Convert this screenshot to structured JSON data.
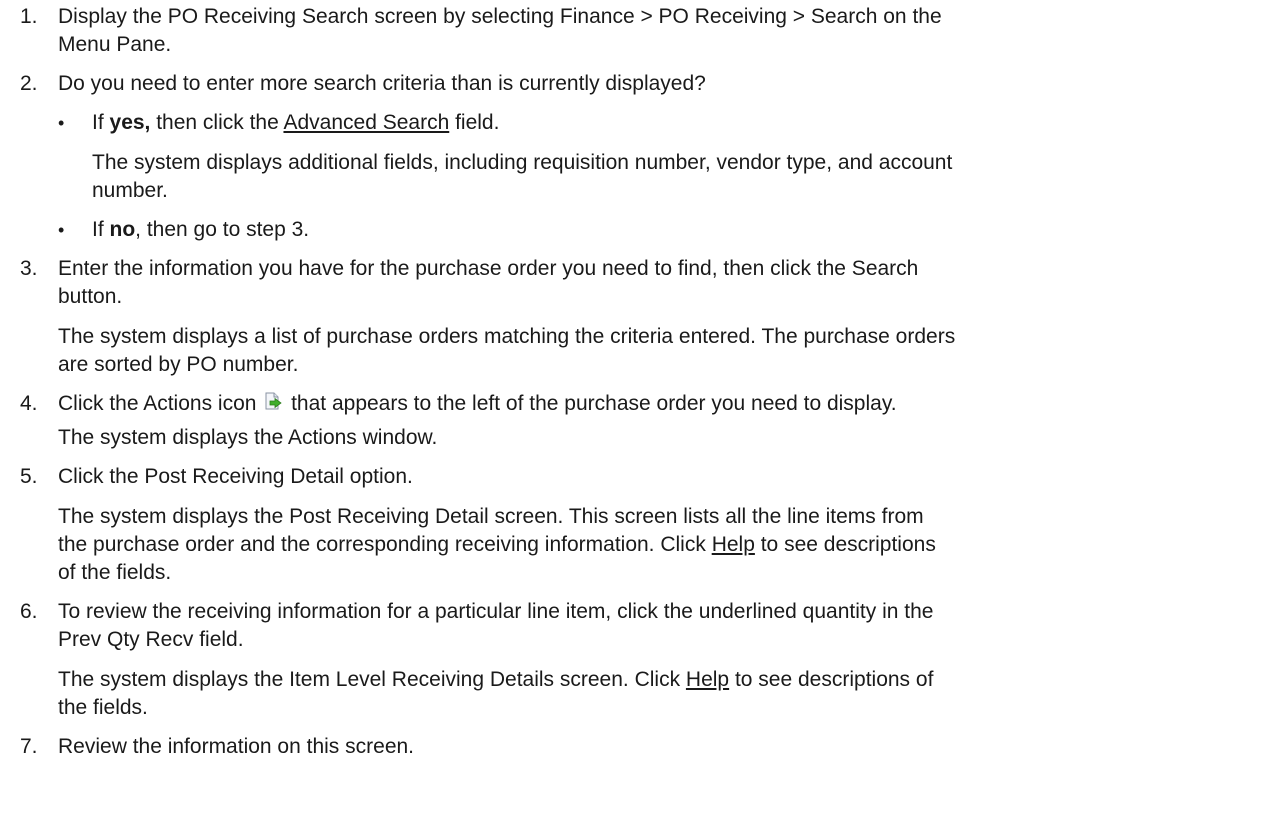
{
  "steps": [
    {
      "num": "1.",
      "lines": [
        "Display the PO Receiving Search screen by selecting Finance > PO Receiving > Search on the",
        "Menu Pane."
      ]
    },
    {
      "num": "2.",
      "text": "Do you need to enter more search criteria than is currently displayed?",
      "bullets": [
        {
          "dot": "•",
          "pre": "If ",
          "bold": "yes,",
          "mid": " then click the ",
          "link": "Advanced Search",
          "post": " field.",
          "note_lines": [
            "The system displays additional fields, including requisition number, vendor type, and account",
            "number."
          ]
        },
        {
          "dot": "•",
          "pre": "If ",
          "bold": "no",
          "post": ", then go to step 3."
        }
      ]
    },
    {
      "num": "3.",
      "lines": [
        "Enter the information you have for the purchase order you need to find, then click the Search",
        "button."
      ],
      "note_lines": [
        "The system displays a list of purchase orders matching the criteria entered. The purchase orders",
        "are sorted by PO number."
      ]
    },
    {
      "num": "4.",
      "pre": "Click the Actions icon ",
      "post": " that appears to the left of the purchase order you need to display.",
      "icon": "actions-page-arrow-icon",
      "note": "The system displays the Actions window."
    },
    {
      "num": "5.",
      "text": "Click the Post Receiving Detail option.",
      "note_lines": [
        "The system displays the Post Receiving Detail screen. This screen lists all the line items from"
      ],
      "note_line2_pre": "the purchase order and the corresponding receiving information. Click ",
      "note_line2_link": "Help",
      "note_line2_post": " to see descriptions",
      "note_line3": "of the fields."
    },
    {
      "num": "6.",
      "lines": [
        "To review the receiving information for a particular line item, click the underlined quantity in the",
        "Prev Qty Recv field."
      ],
      "note_pre": "The system displays the Item Level Receiving Details screen. Click ",
      "note_link": "Help",
      "note_post": " to see descriptions of",
      "note_line2": "the fields."
    },
    {
      "num": "7.",
      "text": "Review the information on this screen."
    }
  ]
}
